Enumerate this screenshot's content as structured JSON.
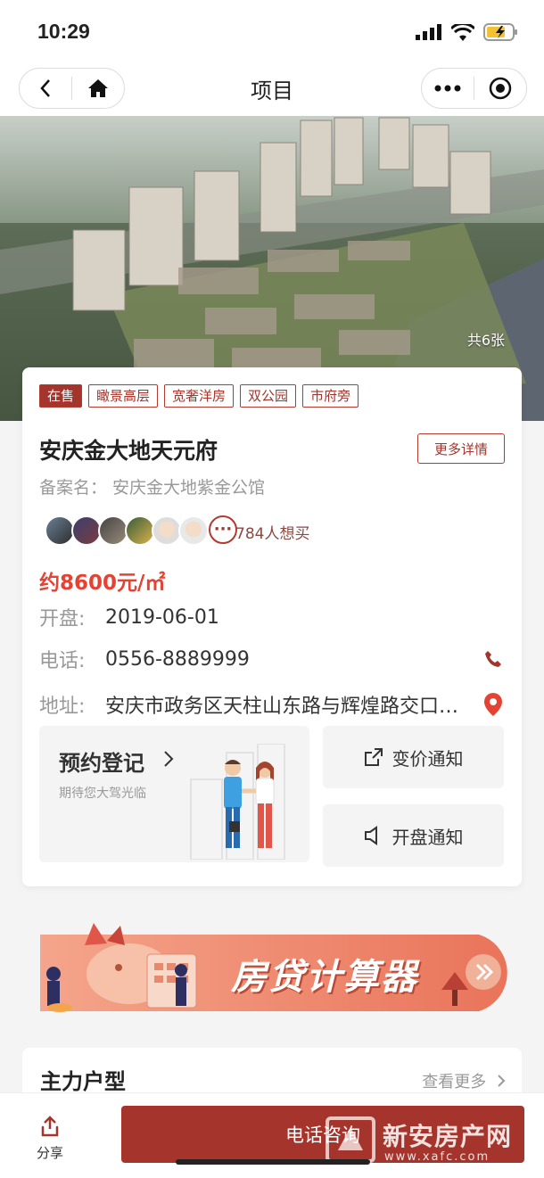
{
  "status_bar": {
    "time": "10:29"
  },
  "nav": {
    "title": "项目"
  },
  "hero": {
    "photo_count": "共6张"
  },
  "project": {
    "tags": [
      "在售",
      "瞰景高层",
      "宽奢洋房",
      "双公园",
      "市府旁"
    ],
    "name": "安庆金大地天元府",
    "more_details": "更多详情",
    "record_name": "备案名： 安庆金大地紫金公馆",
    "want_count": "784人想买",
    "price": "约8600元/㎡",
    "open_label": "开盘:",
    "open_date": "2019-06-01",
    "phone_label": "电话:",
    "phone": "0556-8889999",
    "address_label": "地址:",
    "address": "安庆市政务区天柱山东路与辉煌路交口东南角"
  },
  "appointment": {
    "title": "预约登记",
    "subtitle": "期待您大驾光临"
  },
  "notify": {
    "price_change": "变价通知",
    "opening": "开盘通知"
  },
  "banner": {
    "text": "房贷计算器"
  },
  "section": {
    "title": "主力户型",
    "more": "查看更多"
  },
  "bottom": {
    "share": "分享",
    "call": "电话咨询"
  },
  "watermark": {
    "name": "新安房产网",
    "url": "www.xafc.com"
  },
  "colors": {
    "brand": "#a5352c",
    "price": "#e44233"
  }
}
